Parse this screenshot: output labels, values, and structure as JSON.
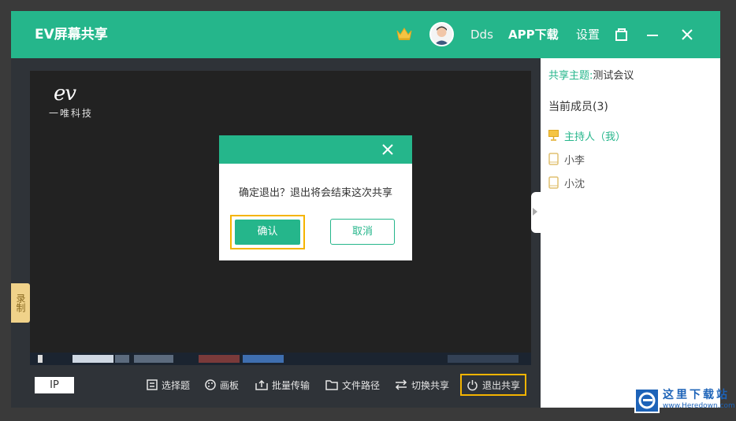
{
  "titlebar": {
    "app_title": "EV屏幕共享",
    "username": "Dds",
    "app_download": "APP下载",
    "settings": "设置"
  },
  "screen": {
    "logo_mark": "ev",
    "logo_company": "一唯科技"
  },
  "side_tab": {
    "record_label": "录制"
  },
  "bottombar": {
    "ip_label": "IP",
    "tools": [
      {
        "label": "选择题",
        "icon": "list-icon"
      },
      {
        "label": "画板",
        "icon": "palette-icon"
      },
      {
        "label": "批量传输",
        "icon": "upload-icon"
      },
      {
        "label": "文件路径",
        "icon": "folder-icon"
      },
      {
        "label": "切换共享",
        "icon": "switch-icon"
      },
      {
        "label": "退出共享",
        "icon": "power-icon"
      }
    ]
  },
  "panel": {
    "topic_key": "共享主题:",
    "topic_value": "测试会议",
    "members_title": "当前成员(3)",
    "members": [
      {
        "name": "主持人（我）",
        "role": "host"
      },
      {
        "name": "小李",
        "role": "member"
      },
      {
        "name": "小沈",
        "role": "member"
      }
    ]
  },
  "dialog": {
    "message": "确定退出？退出将会结束这次共享",
    "confirm_label": "确认",
    "cancel_label": "取消"
  },
  "watermark": {
    "site_cn": "这里下载站",
    "site_url": "www.Heredown.com"
  },
  "colors": {
    "brand_green": "#25b68b",
    "highlight_yellow": "#f5b400",
    "dark_bg": "#2f3338"
  }
}
